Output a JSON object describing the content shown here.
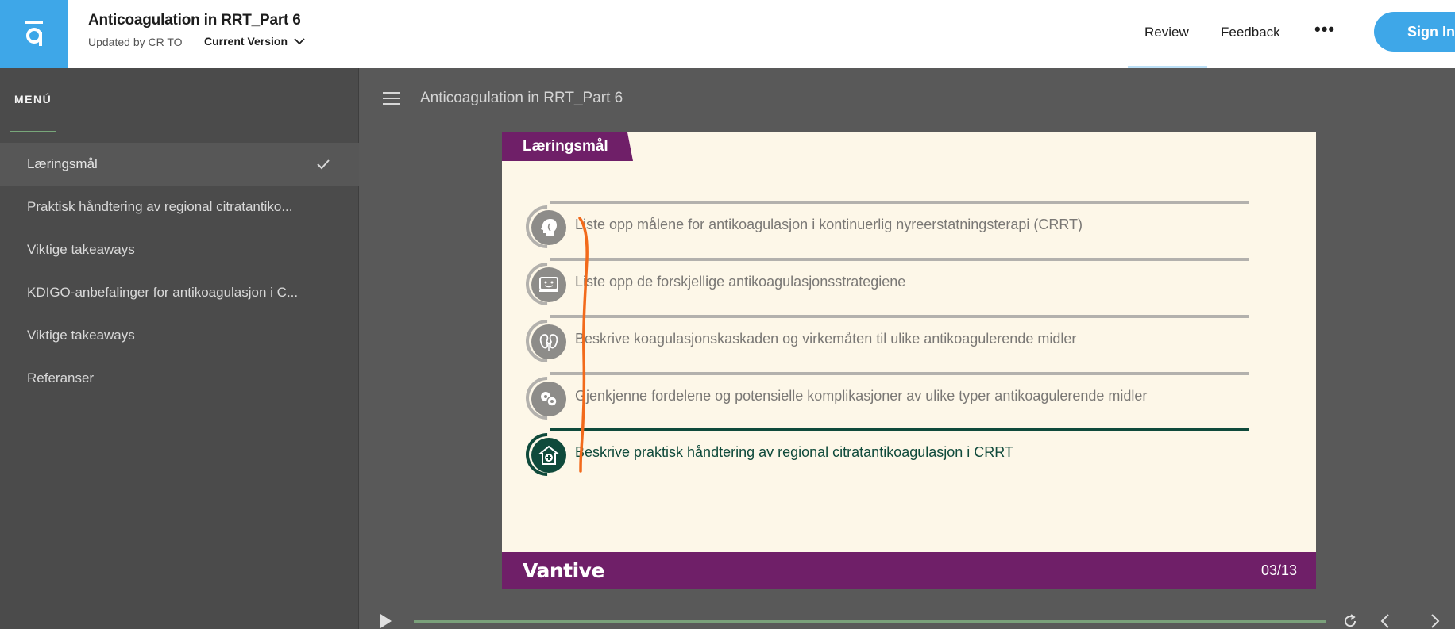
{
  "header": {
    "title": "Anticoagulation in RRT_Part 6",
    "updated_by": "Updated by CR TO",
    "version_label": "Current Version",
    "nav": {
      "review": "Review",
      "feedback": "Feedback",
      "more": "•••",
      "sign_in": "Sign In"
    }
  },
  "sidebar": {
    "heading": "MENÚ",
    "items": [
      {
        "label": "Læringsmål",
        "active": true,
        "completed": true
      },
      {
        "label": "Praktisk håndtering av regional citratantiko...",
        "active": false
      },
      {
        "label": "Viktige takeaways",
        "active": false
      },
      {
        "label": "KDIGO-anbefalinger for antikoagulasjon i C...",
        "active": false
      },
      {
        "label": "Viktige takeaways",
        "active": false
      },
      {
        "label": "Referanser",
        "active": false
      }
    ]
  },
  "main": {
    "content_title": "Anticoagulation in RRT_Part 6",
    "slide": {
      "tab_title": "Læringsmål",
      "objectives": [
        {
          "icon": "head-icon",
          "text": "Liste opp målene for antikoagulasjon i kontinuerlig nyreerstatningsterapi (CRRT)"
        },
        {
          "icon": "monitor-face-icon",
          "text": "Liste opp de forskjellige antikoagulasjonsstrategiene"
        },
        {
          "icon": "kidney-icon",
          "text": "Beskrive koagulasjonskaskaden og virkemåten til ulike antikoagulerende midler"
        },
        {
          "icon": "cells-icon",
          "text": "Gjenkjenne fordelene og potensielle komplikasjoner av ulike typer antikoagulerende midler"
        },
        {
          "icon": "hospital-icon",
          "text": "Beskrive praktisk håndtering av regional citratantikoagulasjon i CRRT",
          "active": true
        }
      ],
      "brand": "Vantive",
      "slide_number": "03/13"
    }
  },
  "colors": {
    "accent_blue": "#3ea7e8",
    "slide_purple": "#6f1f68",
    "active_green": "#0f4a3b",
    "annotation_orange": "#f26a1b"
  }
}
